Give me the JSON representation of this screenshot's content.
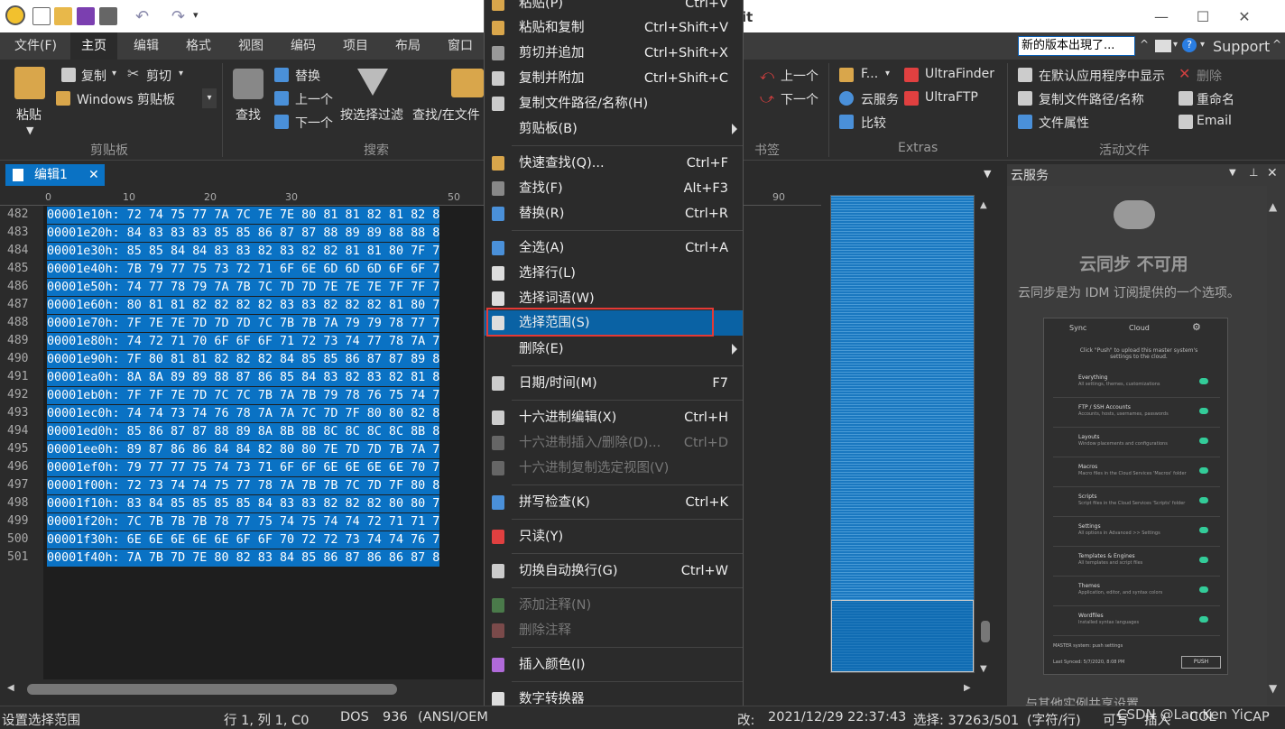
{
  "app": {
    "title_fragment": "it"
  },
  "menu": {
    "items": [
      "文件(F)",
      "主页",
      "编辑",
      "格式",
      "视图",
      "编码",
      "项目",
      "布局",
      "窗口"
    ],
    "active_index": 1
  },
  "update_notice": "新的版本出現了...",
  "support_label": "Support",
  "ribbon": {
    "paste": "粘贴",
    "copy": "复制",
    "cut": "剪切",
    "clipboard": "Windows 剪贴板",
    "clipboard_group": "剪贴板",
    "find": "查找",
    "replace": "替换",
    "prev": "上一个",
    "next": "下一个",
    "filter": "按选择过滤",
    "find_in_files": "查找/在文件",
    "search_group": "搜索",
    "bm_prev": "上一个",
    "bm_next": "下一个",
    "bookmark_group": "书签",
    "f_btn": "F...",
    "ultrafinder": "UltraFinder",
    "cloud": "云服务",
    "ultraftp": "UltraFTP",
    "compare": "比较",
    "extras_group": "Extras",
    "show_default": "在默认应用程序中显示",
    "delete": "删除",
    "copy_path": "复制文件路径/名称",
    "rename": "重命名",
    "file_props": "文件属性",
    "email": "Email",
    "active_file_group": "活动文件"
  },
  "doc_tab": "编辑1",
  "ruler_labels": [
    "0",
    "10",
    "20",
    "30",
    "50",
    "90"
  ],
  "editor": {
    "line_numbers": [
      "482",
      "483",
      "484",
      "485",
      "486",
      "487",
      "488",
      "489",
      "490",
      "491",
      "492",
      "493",
      "494",
      "495",
      "496",
      "497",
      "498",
      "499",
      "500",
      "501"
    ],
    "rows": [
      "00001e10h: 72 74 75 77 7A 7C 7E 7E 80 81 81 82 81 82 8",
      "00001e20h: 84 83 83 83 85 85 86 87 87 88 89 89 88 88 8",
      "00001e30h: 85 85 84 84 83 83 82 83 82 82 81 81 80 7F 7",
      "00001e40h: 7B 79 77 75 73 72 71 6F 6E 6D 6D 6D 6F 6F 7",
      "00001e50h: 74 77 78 79 7A 7B 7C 7D 7D 7E 7E 7E 7F 7F 7",
      "00001e60h: 80 81 81 82 82 82 82 83 83 82 82 82 81 80 7",
      "00001e70h: 7F 7E 7E 7D 7D 7D 7C 7B 7B 7A 79 79 78 77 7",
      "00001e80h: 74 72 71 70 6F 6F 6F 71 72 73 74 77 78 7A 7",
      "00001e90h: 7F 80 81 81 82 82 82 84 85 85 86 87 87 89 8",
      "00001ea0h: 8A 8A 89 89 88 87 86 85 84 83 82 83 82 81 8",
      "00001eb0h: 7F 7F 7E 7D 7C 7C 7B 7A 7B 79 78 76 75 74 7",
      "00001ec0h: 74 74 73 74 76 78 7A 7A 7C 7D 7F 80 80 82 8",
      "00001ed0h: 85 86 87 87 88 89 8A 8B 8B 8C 8C 8C 8C 8B 8",
      "00001ee0h: 89 87 86 86 84 84 82 80 80 7E 7D 7D 7B 7A 7",
      "00001ef0h: 79 77 77 75 74 73 71 6F 6F 6E 6E 6E 6E 70 7",
      "00001f00h: 72 73 74 74 75 77 78 7A 7B 7B 7C 7D 7F 80 8",
      "00001f10h: 83 84 85 85 85 85 84 83 83 82 82 82 80 80 7",
      "00001f20h: 7C 7B 7B 7B 78 77 75 74 75 74 74 72 71 71 7",
      "00001f30h: 6E 6E 6E 6E 6E 6F 6F 70 72 72 73 74 74 76 7",
      "00001f40h: 7A 7B 7D 7E 80 82 83 84 85 86 87 86 86 87 8"
    ]
  },
  "context_menu": {
    "items": [
      {
        "label": "粘贴(P)",
        "shortcut": "Ctrl+V",
        "icon": "paste-icon"
      },
      {
        "label": "粘贴和复制",
        "shortcut": "Ctrl+Shift+V",
        "icon": "paste-copy-icon"
      },
      {
        "label": "剪切并追加",
        "shortcut": "Ctrl+Shift+X",
        "icon": "cut-append-icon"
      },
      {
        "label": "复制并附加",
        "shortcut": "Ctrl+Shift+C",
        "icon": "copy-append-icon"
      },
      {
        "label": "复制文件路径/名称(H)",
        "shortcut": "",
        "icon": "copy-path-icon"
      },
      {
        "label": "剪贴板(B)",
        "shortcut": "",
        "icon": "",
        "submenu": true
      },
      {
        "label": "快速查找(Q)...",
        "shortcut": "Ctrl+F",
        "icon": "quick-find-icon"
      },
      {
        "label": "查找(F)",
        "shortcut": "Alt+F3",
        "icon": "find-icon"
      },
      {
        "label": "替换(R)",
        "shortcut": "Ctrl+R",
        "icon": "replace-icon"
      },
      {
        "label": "全选(A)",
        "shortcut": "Ctrl+A",
        "icon": "select-all-icon"
      },
      {
        "label": "选择行(L)",
        "shortcut": "",
        "icon": "select-line-icon"
      },
      {
        "label": "选择词语(W)",
        "shortcut": "",
        "icon": "select-word-icon"
      },
      {
        "label": "选择范围(S)",
        "shortcut": "",
        "icon": "select-range-icon",
        "highlighted": true
      },
      {
        "label": "删除(E)",
        "shortcut": "",
        "icon": "",
        "submenu": true
      },
      {
        "label": "日期/时间(M)",
        "shortcut": "F7",
        "icon": "datetime-icon"
      },
      {
        "label": "十六进制编辑(X)",
        "shortcut": "Ctrl+H",
        "icon": "hex-edit-icon"
      },
      {
        "label": "十六进制插入/删除(D)...",
        "shortcut": "Ctrl+D",
        "icon": "hex-insert-icon",
        "disabled": true
      },
      {
        "label": "十六进制复制选定视图(V)",
        "shortcut": "",
        "icon": "hex-copy-icon",
        "disabled": true
      },
      {
        "label": "拼写检查(K)",
        "shortcut": "Ctrl+K",
        "icon": "spellcheck-icon"
      },
      {
        "label": "只读(Y)",
        "shortcut": "",
        "icon": "readonly-icon"
      },
      {
        "label": "切换自动换行(G)",
        "shortcut": "Ctrl+W",
        "icon": "wordwrap-icon"
      },
      {
        "label": "添加注释(N)",
        "shortcut": "",
        "icon": "add-comment-icon",
        "disabled": true
      },
      {
        "label": "删除注释",
        "shortcut": "",
        "icon": "remove-comment-icon",
        "disabled": true
      },
      {
        "label": "插入颜色(I)",
        "shortcut": "",
        "icon": "insert-color-icon"
      },
      {
        "label": "数字转换器",
        "shortcut": "",
        "icon": "number-converter-icon"
      }
    ]
  },
  "cloud_panel": {
    "title": "云服务",
    "heading": "云同步 不可用",
    "desc": "云同步是为 IDM 订阅提供的一个选项。",
    "tabs": [
      "Sync",
      "Cloud"
    ],
    "intro": "Click \"Push\" to upload this master system's settings to the cloud.",
    "rows": [
      {
        "t": "Everything",
        "s": "All settings, themes, customizations"
      },
      {
        "t": "FTP / SSH Accounts",
        "s": "Accounts, hosts, usernames, passwords"
      },
      {
        "t": "Layouts",
        "s": "Window placements and configurations"
      },
      {
        "t": "Macros",
        "s": "Macro files in the Cloud Services 'Macros' folder"
      },
      {
        "t": "Scripts",
        "s": "Script files in the Cloud Services 'Scripts' folder"
      },
      {
        "t": "Settings",
        "s": "All options in Advanced >> Settings"
      },
      {
        "t": "Templates & Engines",
        "s": "All templates and script files"
      },
      {
        "t": "Themes",
        "s": "Application, editor, and syntax colors"
      },
      {
        "t": "Wordfiles",
        "s": "Installed syntax languages"
      }
    ],
    "master_note": "MASTER system: push settings",
    "last_synced": "Last Synced: 5/7/2020, 8:08 PM",
    "push": "PUSH",
    "footer": "与其他实例共享设置"
  },
  "status": {
    "left": "设置选择范围",
    "pos": "行 1, 列 1, C0",
    "eol": "DOS",
    "codepage": "936",
    "encoding": "(ANSI/OEM",
    "modified_label": "改:",
    "modified": "2021/12/29 22:37:43",
    "selection": "选择: 37263/501",
    "unit": "(字符/行)",
    "writable": "可写",
    "insert": "插入",
    "col": "COL",
    "cap": "CAP",
    "watermark": "CSDN @Lan Ken Yi"
  },
  "colors": {
    "accent": "#0a72c4",
    "highlight_border": "#e53935"
  }
}
